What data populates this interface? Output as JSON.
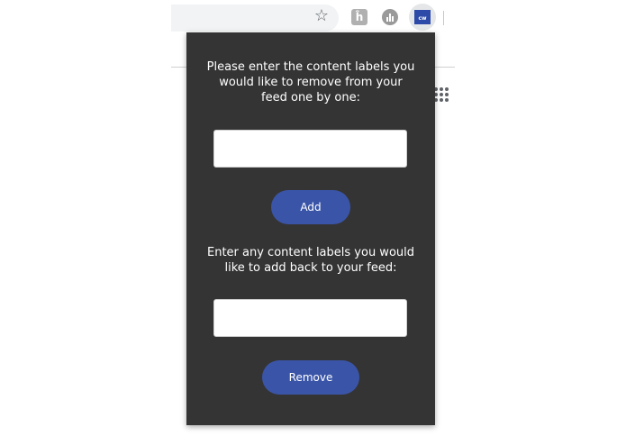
{
  "toolbar": {
    "bookmark_icon": "star-icon",
    "extensions": [
      {
        "name": "h-extension-icon",
        "glyph": "ĥ"
      },
      {
        "name": "chart-extension-icon"
      },
      {
        "name": "cw-extension-icon",
        "label": "cw"
      }
    ]
  },
  "popup": {
    "remove_prompt": "Please enter the content labels you would like to remove from your feed one by one:",
    "remove_input": {
      "value": "",
      "placeholder": ""
    },
    "add_button_label": "Add",
    "add_back_prompt": "Enter any content labels you would like to add back to your feed:",
    "add_back_input": {
      "value": "",
      "placeholder": ""
    },
    "remove_button_label": "Remove",
    "colors": {
      "background": "#353434",
      "button": "#3a55a8",
      "text": "#ffffff"
    }
  }
}
